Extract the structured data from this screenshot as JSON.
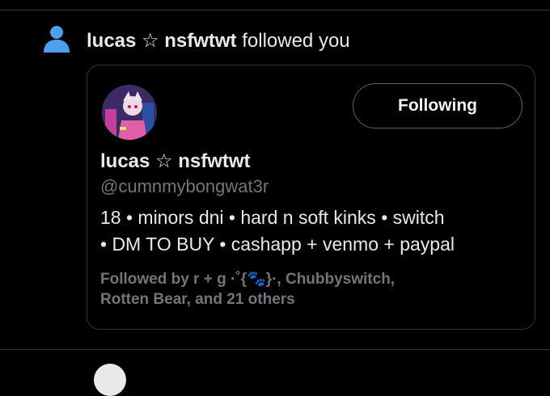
{
  "notification": {
    "user_name": "lucas ☆ nsfwtwt",
    "action_text": " followed you",
    "icon": "person-icon",
    "icon_color": "#4d9ff0"
  },
  "card": {
    "avatar_icon": "profile-avatar",
    "follow_button_label": "Following",
    "name": "lucas ☆ nsfwtwt",
    "handle": "@cumnmybongwat3r",
    "bio_line1": "18 • minors dni • hard n soft kinks • switch",
    "bio_line2": "• DM TO BUY • cashapp + venmo + paypal",
    "followed_by_line1": "Followed by r + g ·˚{🐾}·, Chubbyswitch,",
    "followed_by_line2": "Rotten Bear, and 21 others"
  },
  "colors": {
    "background": "#000000",
    "text_primary": "#e7e9ea",
    "text_secondary": "#71767b",
    "border": "#2f3336",
    "accent": "#4d9ff0"
  }
}
